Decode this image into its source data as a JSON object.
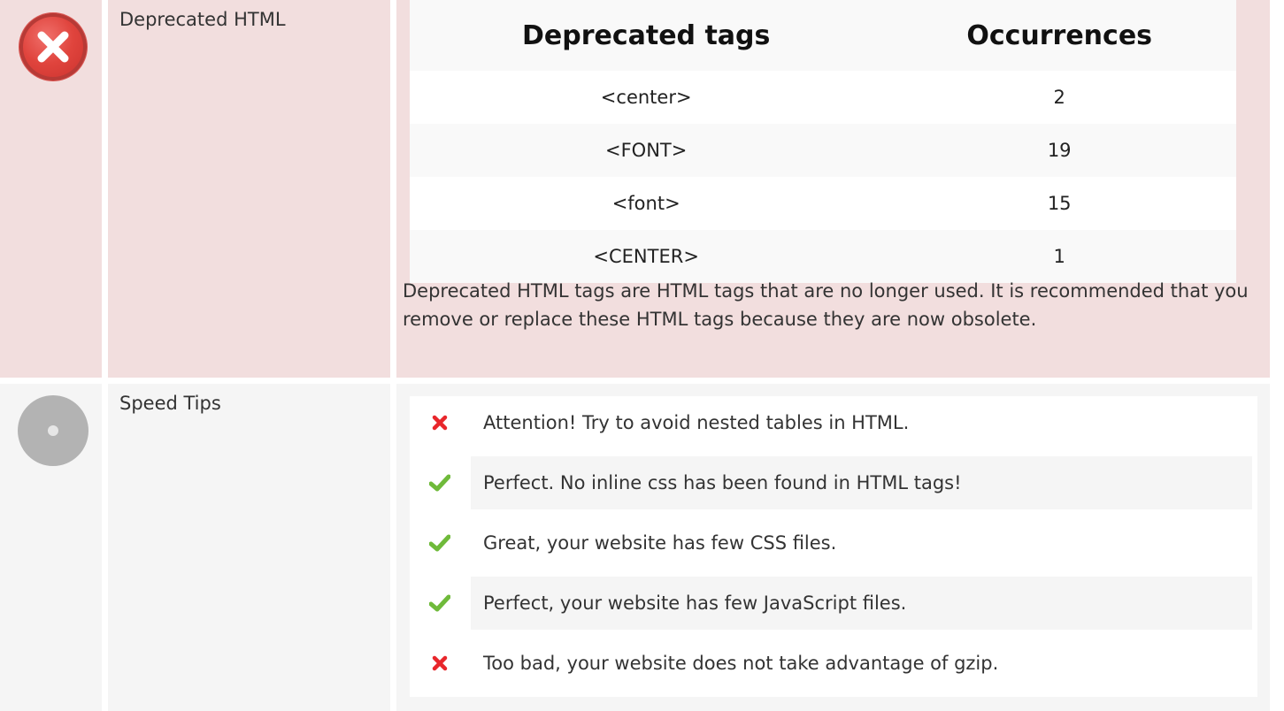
{
  "deprecated_html": {
    "label": "Deprecated HTML",
    "status": "error",
    "table": {
      "headers": [
        "Deprecated tags",
        "Occurrences"
      ],
      "rows": [
        {
          "tag": "<center>",
          "count": "2"
        },
        {
          "tag": "<FONT>",
          "count": "19"
        },
        {
          "tag": "<font>",
          "count": "15"
        },
        {
          "tag": "<CENTER>",
          "count": "1"
        }
      ]
    },
    "description": "Deprecated HTML tags are HTML tags that are no longer used. It is recommended that you remove or replace these HTML tags because they are now obsolete."
  },
  "speed_tips": {
    "label": "Speed Tips",
    "status": "neutral",
    "items": [
      {
        "icon": "cross-icon",
        "text": "Attention! Try to avoid nested tables in HTML."
      },
      {
        "icon": "check-icon",
        "text": "Perfect. No inline css has been found in HTML tags!"
      },
      {
        "icon": "check-icon",
        "text": "Great, your website has few CSS files."
      },
      {
        "icon": "check-icon",
        "text": "Perfect, your website has few JavaScript files."
      },
      {
        "icon": "cross-icon",
        "text": "Too bad, your website does not take advantage of gzip."
      }
    ]
  },
  "colors": {
    "error_bg": "#f2dede",
    "neutral_bg": "#f5f5f5",
    "cross": "#e8262b",
    "check": "#6fba3a"
  }
}
